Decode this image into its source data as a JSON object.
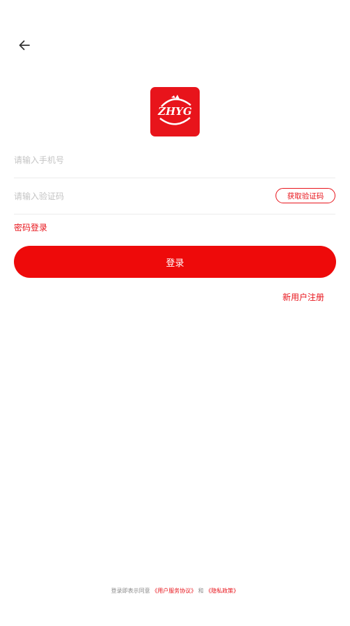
{
  "logo": {
    "text": "ZHYG",
    "bg_color": "#e8141b"
  },
  "form": {
    "phone_placeholder": "请输入手机号",
    "code_placeholder": "请输入验证码",
    "get_code_label": "获取验证码"
  },
  "password_login_label": "密码登录",
  "login_label": "登录",
  "register_label": "新用户注册",
  "agreement": {
    "prefix": "登录即表示同意",
    "user_agreement": "《用户服务协议》",
    "conjunction": "和",
    "privacy_policy": "《隐私政策》"
  },
  "colors": {
    "accent": "#e8141b",
    "button": "#ee0a0a",
    "placeholder": "#c4c4c4"
  },
  "icons": {
    "back": "arrow-left-icon"
  }
}
